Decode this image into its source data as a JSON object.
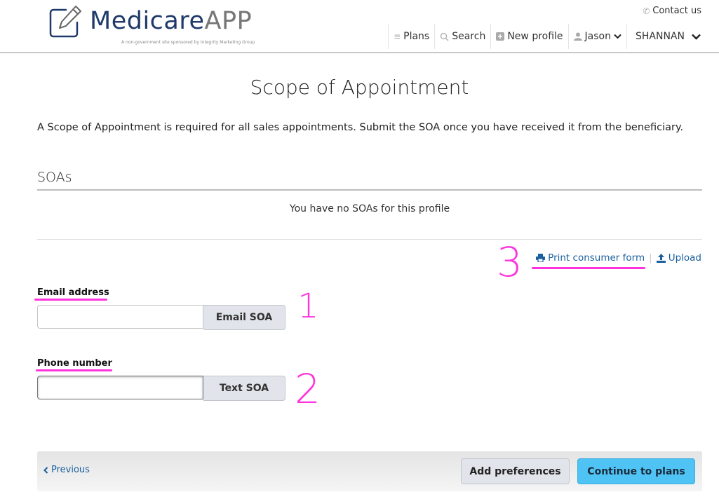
{
  "header": {
    "logo_primary": "Medicare",
    "logo_secondary": "APP",
    "tagline": "A non-government site sponsored by Integrity Marketing Group",
    "contact_label": "Contact us",
    "nav": [
      {
        "label": "Plans",
        "icon": "layers-icon"
      },
      {
        "label": "Search",
        "icon": "search-icon"
      },
      {
        "label": "New profile",
        "icon": "plus-square-icon"
      },
      {
        "label": "Jason",
        "icon": "user-icon"
      },
      {
        "label": "SHANNAN",
        "icon": "chevron-down-icon"
      }
    ]
  },
  "page": {
    "title": "Scope of Appointment",
    "intro": "A Scope of Appointment is required for all sales appointments. Submit the SOA once you have received it from the beneficiary."
  },
  "soas": {
    "heading": "SOAs",
    "empty_message": "You have no SOAs for this profile"
  },
  "actions": {
    "print_label": "Print consumer form",
    "separator": "|",
    "upload_label": "Upload"
  },
  "email": {
    "label": "Email address",
    "value": "",
    "placeholder": "",
    "button_label": "Email SOA"
  },
  "phone": {
    "label": "Phone number",
    "value": "",
    "placeholder": "",
    "button_label": "Text SOA"
  },
  "annotations": [
    "1",
    "2",
    "3"
  ],
  "footer": {
    "previous_label": "Previous",
    "add_preferences_label": "Add preferences",
    "continue_label": "Continue to plans"
  },
  "colors": {
    "brand_navy": "#1f3a6a",
    "link_blue": "#1a5f9e",
    "primary_button": "#4fc3f4",
    "annotation_magenta": "#ff33dd"
  }
}
